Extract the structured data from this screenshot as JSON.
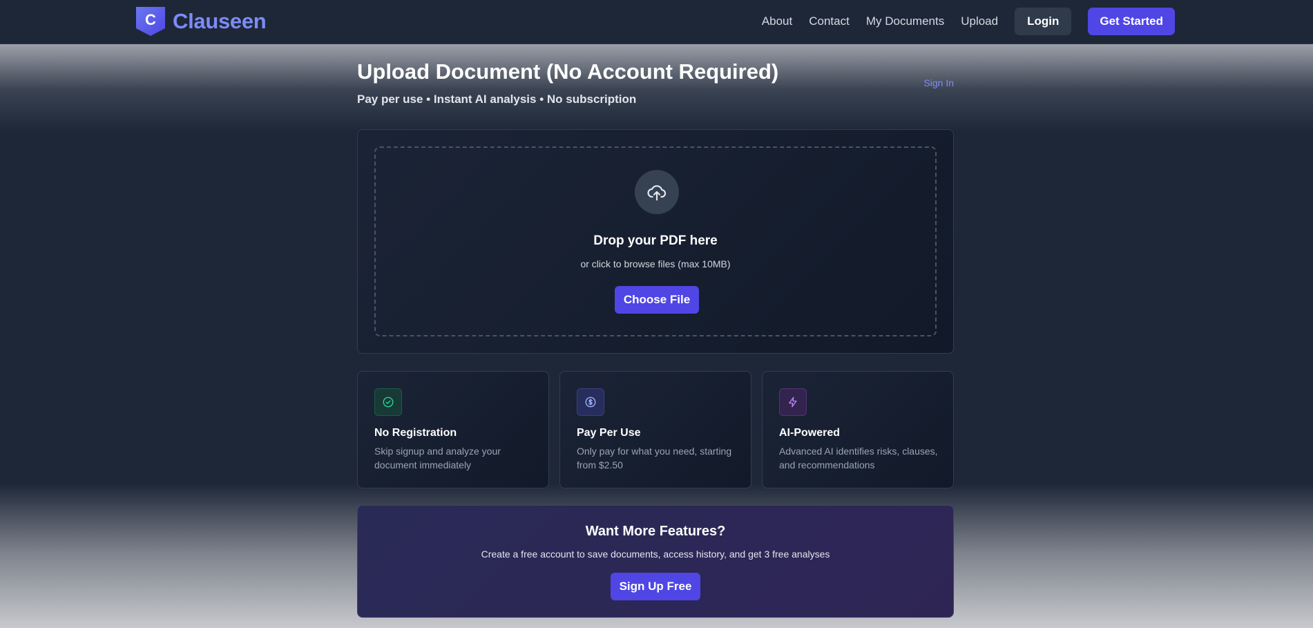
{
  "colors": {
    "nav_bg": "#1e2738",
    "brand_text": "#7c8cf4",
    "primary": "#4f46e5",
    "link": "#818cf8",
    "green_accent": "#34d399",
    "indigo_accent": "#a5b4fc",
    "purple_accent": "#c084fc"
  },
  "nav": {
    "brand_letter": "C",
    "brand_name": "Clauseen",
    "brand_icon": "shield-icon",
    "links": [
      "About",
      "Contact",
      "My Documents",
      "Upload"
    ],
    "login_label": "Login",
    "get_started_label": "Get Started"
  },
  "page": {
    "title": "Upload Document (No Account Required)",
    "subtitle": "Pay per use • Instant AI analysis • No subscription",
    "sign_in_label": "Sign In"
  },
  "upload": {
    "icon": "cloud-upload-icon",
    "title": "Drop your PDF here",
    "subtitle": "or click to browse files (max 10MB)",
    "button_label": "Choose File"
  },
  "features": [
    {
      "icon": "check-circle-icon",
      "title": "No Registration",
      "description": "Skip signup and analyze your document immediately"
    },
    {
      "icon": "dollar-circle-icon",
      "title": "Pay Per Use",
      "description": "Only pay for what you need, starting from $2.50"
    },
    {
      "icon": "lightning-icon",
      "title": "AI-Powered",
      "description": "Advanced AI identifies risks, clauses, and recommendations"
    }
  ],
  "cta": {
    "title": "Want More Features?",
    "description": "Create a free account to save documents, access history, and get 3 free analyses",
    "button_label": "Sign Up Free"
  }
}
